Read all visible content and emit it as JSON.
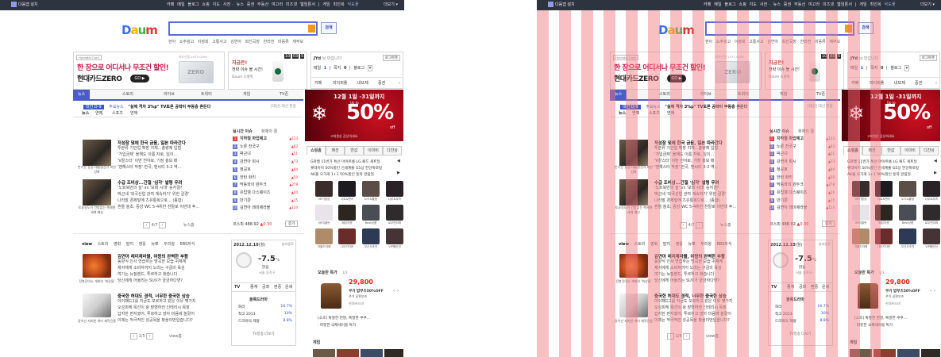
{
  "topbar": {
    "install": "다음앱 설치",
    "nav": [
      "카페",
      "메일",
      "블로그",
      "쇼핑",
      "지도",
      "사전",
      "뉴스",
      "증권",
      "부동산",
      "여고라",
      "미즈넷",
      "웹임툰서"
    ],
    "game_label": "게임",
    "lottery_label": "최인복",
    "weather_label": "낙도꽃",
    "more_label": "더보기"
  },
  "logo": {
    "text": "Daum"
  },
  "search": {
    "value": "",
    "button_label": "검색",
    "suggestions": [
      "현아 소주광고",
      "이정희 고통사고",
      "김연아 회선곡장",
      "한라전 미동류 재부모"
    ]
  },
  "ads": {
    "card_brand": "Hyundai Card",
    "card_line1": "한 장으로 어디서나 무조건 할인!",
    "card_line2": "현대카드ZERO",
    "card_go": "GO",
    "card_phone": "카드신청 1577-0100",
    "card_zero": "ZERO",
    "coffee_head": "지금은!",
    "coffee_line1": "전략 이슈 볼 시간!",
    "coffee_line2": "Daum 소셜픽",
    "timer": [
      "10",
      "03",
      "5"
    ]
  },
  "login": {
    "user": "JYd",
    "user_suffix": "님 반갑니다",
    "logout": "로그아웃",
    "stats": [
      {
        "label": "메일",
        "value": "1"
      },
      {
        "label": "쪽지",
        "value": "0"
      },
      {
        "label": "블로그",
        "value": ""
      }
    ],
    "shortcuts": [
      "카페",
      "마이피플",
      "내또제",
      "증권"
    ]
  },
  "tabs": [
    "뉴스",
    "스토리",
    "라이브",
    "트위터",
    "게임",
    "TV존"
  ],
  "breaking": {
    "badge": "대선 D-9",
    "text": "주요뉴스",
    "headline": "\"실제 격차 3%p\" TV토론 공략이 부동층 흔든다",
    "sub": "[대선] 대선 현장"
  },
  "news_tabs": [
    "뉴스",
    "연예",
    "스포츠",
    "연애"
  ],
  "news": [
    {
      "caption": "반기문 송정 대통령선거 비판 강화",
      "title": "저성장 덫에 한국 금융, 일본 따라간다",
      "lines": [
        "투분류 기안업 확장 지체...총량제 입법",
        "'가입금제' 올해도 이름 자로, 일이...",
        "'V끝스터' 이번 전야로, 기장 홍보 매",
        "'맨해스터 작장' 한국, 맨씨티 3-2 역…"
      ]
    },
    {
      "caption": "토요일도이 건방없는 축제엔 세계 예상",
      "title": "수급 조비상...간절 '심각' 발령 우려",
      "lines": [
        "'노트북만의 실' vs '모레 시대' 승지결?",
        "박근네 '외국산업 관여 계속하기' 위한 갈경'",
        "나리발 경제앞에 츠유통복으로... (종합)",
        "흔들 울초, 중앙 WC 5-4위한 찬탈로 이반대 후..."
      ]
    }
  ],
  "news_pager": {
    "page": "4",
    "total": "7",
    "more": "뉴스홈"
  },
  "realtime": {
    "title": "실시간 이슈",
    "tab2": "화제의 결",
    "items": [
      {
        "rank": "1",
        "label": "지하철 파업예고",
        "count": "▲123"
      },
      {
        "rank": "2",
        "label": "노론 전국구",
        "count": "▲63"
      },
      {
        "rank": "3",
        "label": "박근녀",
        "count": "▲51"
      },
      {
        "rank": "4",
        "label": "강연아 회시",
        "count": "▲73"
      },
      {
        "rank": "5",
        "label": "정공호",
        "count": "▲84"
      },
      {
        "rank": "6",
        "label": "한턴 화리",
        "count": "▲50"
      },
      {
        "rank": "7",
        "label": "막동와의 원두크",
        "count": "▲278"
      },
      {
        "rank": "8",
        "label": "유럽웰 다스웨이즈",
        "count": "▲20"
      },
      {
        "rank": "9",
        "label": "만기쫀",
        "count": "▲15"
      },
      {
        "rank": "10",
        "label": "김연아 레미제라블",
        "count": "▲124"
      }
    ],
    "kospi_label": "코스피",
    "kospi": "488.92",
    "change": "▲0.30",
    "more": "증가"
  },
  "categories": [
    "view",
    "스토리",
    "영화",
    "말지",
    "영웅",
    "뉴뽀",
    "두리윙",
    "EBS자식"
  ],
  "stories": [
    {
      "caption": "전봉진야소 개최의 '화상들'",
      "title": "김연아 레미제라블, 여왕의 완벽한 부활",
      "lines": [
        "동양식 인사 연습하는 명곡한 모습 귀재계",
        "제서에게 소비자까지 노리는 구글의 육심",
        "여기는 뉴질랜드, 투르하고 화습니다",
        "당신에게 어울리는 SUV가 궁금하다면?"
      ]
    },
    {
      "caption": "갈이산 지퍼한 여러 제작진들",
      "title": "중국한 허대도 경적, 너무한 중국한 상승",
      "lines": [
        "아이패드2를 지금도 모르하고 같은 이유 몇가지",
        "오성피케 목선이 왕 맡했하전 인테리시 목장",
        "갑자한 펀지였어, 투르하고 많아 미음에 놀랐어",
        "이제는 적극적인 성공목을 찾을이번입습니다?"
      ]
    }
  ],
  "story_pager": {
    "page": "1",
    "total": "5",
    "more": "view홈"
  },
  "weather": {
    "date": "2012.12.10",
    "day": "(월)",
    "region": "날씨중료",
    "temp": "-7.5",
    "unit": "°c",
    "desc": "맑음",
    "place": "서울 동작구"
  },
  "tv": {
    "title": "TV",
    "tabs": [
      "종계",
      "공좌",
      "판중",
      "운세"
    ],
    "subtitle": "블록드라마",
    "items": [
      {
        "label": "화라",
        "value": "16.7%"
      },
      {
        "label": "착고 2013",
        "value": "10%"
      },
      {
        "label": "드라마의 제왕",
        "value": "8.8%"
      }
    ],
    "more": "TV방송 더보기"
  },
  "sale_banner": {
    "title": "12월 1일 -31일까지",
    "up": "Up to",
    "pct": "50%",
    "off": "off",
    "sub": "고회원상 감상의세요"
  },
  "shop": {
    "tabs": [
      "쇼핑홈",
      "패션",
      "반값",
      "이미비",
      "디잔상"
    ],
    "lines": [
      "G마켓 11번가 특선 아이트롬 LG 패드 세트딜",
      "롯데아이 50%할인 신세계몰 G5상 한강특로팅",
      "AK몰 오가게 1+1 50%할인 동쪽 알림딜"
    ],
    "products": [
      "VR기본감",
      "니트&팬츠",
      "노드&플팀",
      "나무트부츠",
      "VR여클랏",
      "패딩자켓",
      "Best상품",
      "로우먼이퍼",
      "겨울드라패",
      "나이키다운",
      "무신사추천",
      "VIP할인전"
    ]
  },
  "today": {
    "title": "오늘만 특가",
    "badge": "1/3",
    "price": "29,800",
    "name": "쿠거 밥부츠50%OFF",
    "brand": "쿠거 남편부츠",
    "store": "현대Hmall",
    "links": [
      "[소호] 톡발한 연말, 톡발한 쿠쿠…",
      "· 따뜻한 국제세이블 특가"
    ]
  },
  "game": {
    "title": "게임"
  },
  "colors": {
    "accent": "#4a5cc8",
    "topbar": "#2e3340",
    "red": "#e43b3b",
    "overlay": "#f2737d"
  }
}
